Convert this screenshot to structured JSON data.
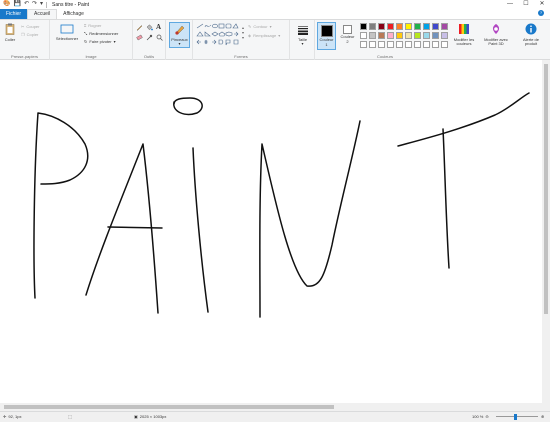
{
  "window": {
    "title": "Sans titre - Paint",
    "controls": {
      "minimize": "—",
      "maximize": "☐",
      "close": "✕"
    },
    "quick_access": [
      "save-icon",
      "undo-icon",
      "redo-icon",
      "customize-icon"
    ]
  },
  "tabs": [
    {
      "label": "Fichier"
    },
    {
      "label": "Accueil"
    },
    {
      "label": "Affichage"
    }
  ],
  "ribbon": {
    "clipboard": {
      "label": "Presse-papiers",
      "paste": "Coller",
      "cut": "Couper",
      "copy": "Copier"
    },
    "image": {
      "label": "Image",
      "select": "Sélectionner",
      "crop": "Rogner",
      "resize": "Redimensionner",
      "rotate": "Faire pivoter"
    },
    "tools": {
      "label": "Outils"
    },
    "brushes": {
      "label": "Pinceaux"
    },
    "shapes": {
      "label": "Formes",
      "outline": "Contour",
      "fill": "Remplissage"
    },
    "size": {
      "label": "Taille"
    },
    "colors": {
      "label": "Couleurs",
      "color1_line1": "Couleur",
      "color1_line2": "1",
      "color2_line1": "Couleur",
      "color2_line2": "2",
      "edit_colors_line1": "Modifier les",
      "edit_colors_line2": "couleurs",
      "edit_paint3d_line1": "Modifier avec",
      "edit_paint3d_line2": "Paint 3D",
      "product_alert_line1": "Alerte de",
      "product_alert_line2": "produit",
      "color1_value": "#000000",
      "color2_value": "#ffffff",
      "palette_row1": [
        "#000000",
        "#7f7f7f",
        "#880015",
        "#ed1c24",
        "#ff7f27",
        "#fff200",
        "#22b14c",
        "#00a2e8",
        "#3f48cc",
        "#a349a4"
      ],
      "palette_row2": [
        "#ffffff",
        "#c3c3c3",
        "#b97a57",
        "#ffaec9",
        "#ffc90e",
        "#efe4b0",
        "#b5e61d",
        "#99d9ea",
        "#7092be",
        "#c8bfe7"
      ],
      "palette_row3": [
        "#ffffff",
        "#ffffff",
        "#ffffff",
        "#ffffff",
        "#ffffff",
        "#ffffff",
        "#ffffff",
        "#ffffff",
        "#ffffff",
        "#ffffff"
      ]
    },
    "accent": "#1979ca"
  },
  "status": {
    "cursor_pos": "92, 1px",
    "selection": "",
    "canvas_size": "2025 × 1003px",
    "zoom": "100 %"
  }
}
